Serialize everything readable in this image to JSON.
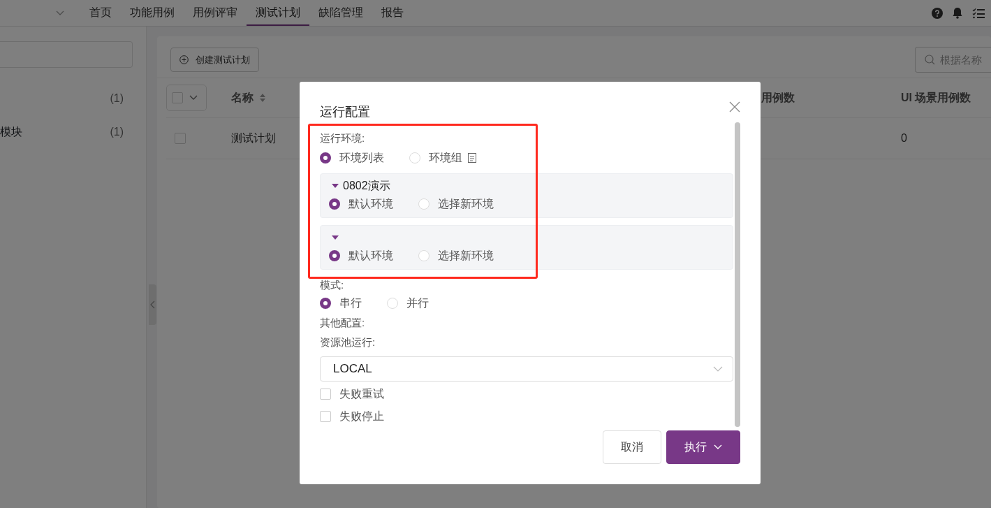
{
  "nav": {
    "tabs": [
      {
        "label": "首页",
        "selected": false
      },
      {
        "label": "功能用例",
        "selected": false
      },
      {
        "label": "用例评审",
        "selected": false
      },
      {
        "label": "测试计划",
        "selected": true
      },
      {
        "label": "缺陷管理",
        "selected": false
      },
      {
        "label": "报告",
        "selected": false
      }
    ]
  },
  "sidebar": {
    "tree": [
      {
        "count": "(1)"
      },
      {
        "label": "模块",
        "count": "(1)"
      }
    ]
  },
  "main": {
    "create_button": "创建测试计划",
    "search": {
      "placeholder": "根据名称"
    },
    "table": {
      "columns": [
        {
          "label": "名称",
          "sortable": true
        },
        {
          "label": "用例数",
          "sortable": false
        },
        {
          "label": "UI 场景用例数",
          "sortable": false
        }
      ],
      "rows": [
        {
          "checked": false,
          "cells": [
            "测试计划",
            null,
            "0"
          ]
        }
      ]
    }
  },
  "dialog": {
    "title": "运行配置",
    "env_label": "运行环境:",
    "env_modes": [
      {
        "label": "环境列表",
        "selected": true,
        "has_icon": false
      },
      {
        "label": "环境组",
        "selected": false,
        "has_icon": true
      }
    ],
    "projects": [
      {
        "name": "0802演示",
        "expanded": true,
        "options": [
          {
            "label": "默认环境",
            "selected": true
          },
          {
            "label": "选择新环境",
            "selected": false
          }
        ]
      },
      {
        "expanded": true,
        "options": [
          {
            "label": "默认环境",
            "selected": true
          },
          {
            "label": "选择新环境",
            "selected": false
          }
        ]
      }
    ],
    "mode_label": "模式:",
    "modes": [
      {
        "label": "串行",
        "selected": true
      },
      {
        "label": "并行",
        "selected": false
      }
    ],
    "other_label": "其他配置:",
    "pool_label": "资源池运行:",
    "pool_value": "LOCAL",
    "checkboxes": [
      {
        "label": "失败重试",
        "checked": false
      },
      {
        "label": "失败停止",
        "checked": false
      }
    ],
    "buttons": [
      {
        "label": "取消",
        "kind": "secondary"
      },
      {
        "label": "执行",
        "kind": "primary"
      }
    ]
  }
}
